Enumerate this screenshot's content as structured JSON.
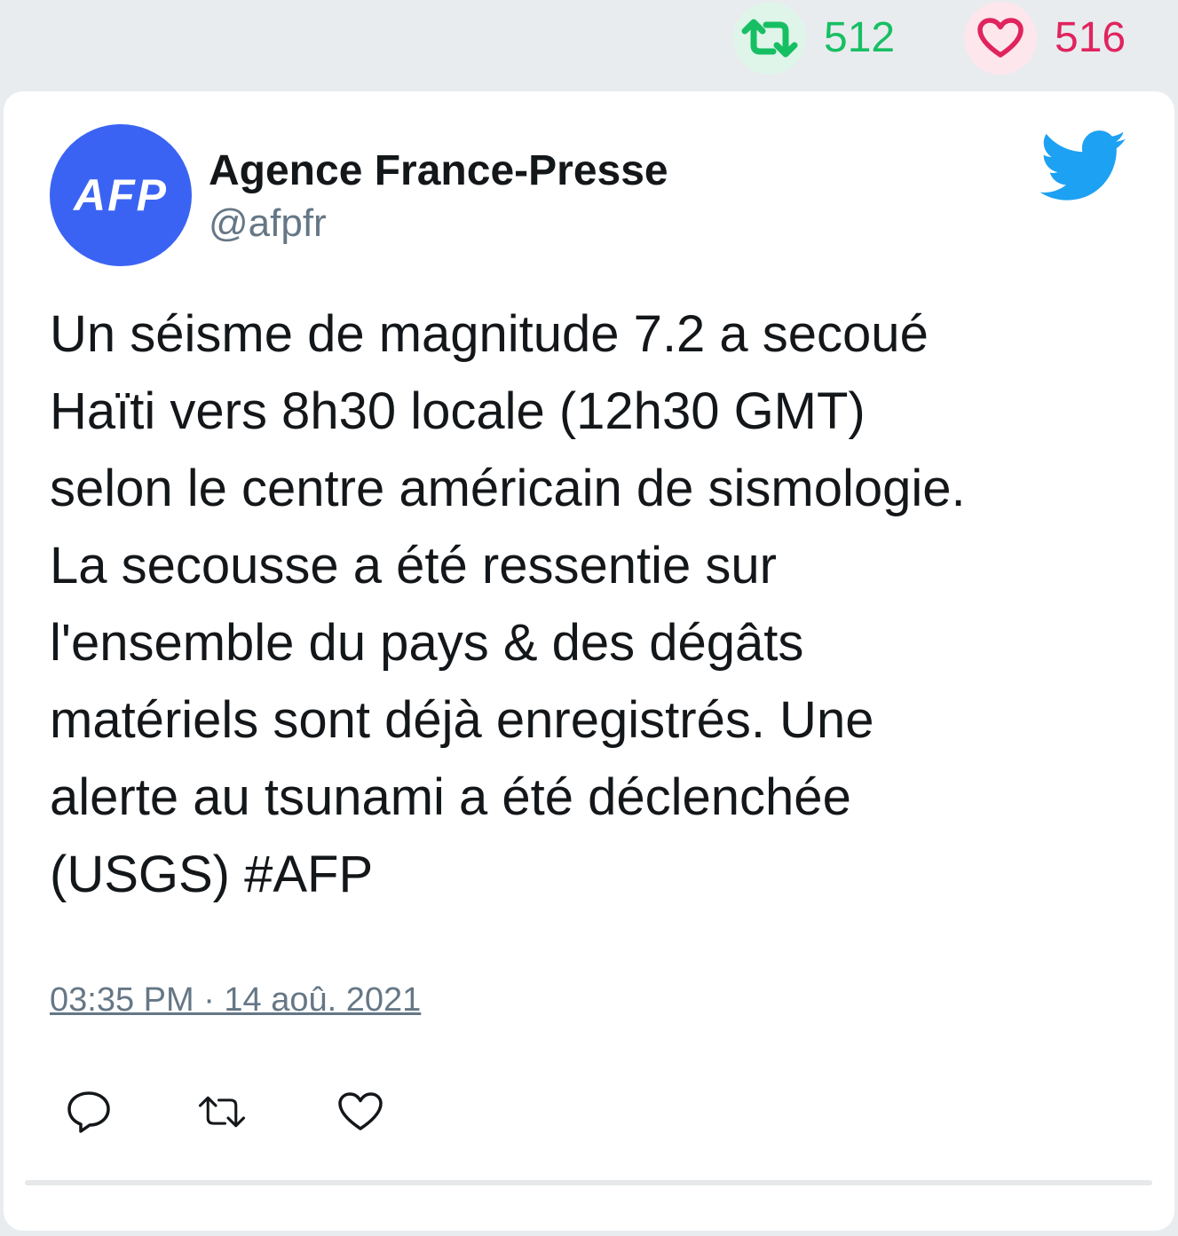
{
  "stats": {
    "retweets": {
      "count": "512",
      "icon": "retweet-icon",
      "color": "#17bf63"
    },
    "likes": {
      "count": "516",
      "icon": "heart-icon",
      "color": "#e0245e"
    }
  },
  "tweet": {
    "avatar_text": "AFP",
    "author_name": "Agence France-Presse",
    "author_handle": "@afpfr",
    "brand_icon": "twitter-bird-icon",
    "brand_color": "#1da1f2",
    "text_lines": [
      "Un séisme de magnitude 7.2 a secoué",
      "Haïti vers 8h30 locale (12h30 GMT)",
      "selon le centre américain de sismologie.",
      "La secousse a été ressentie sur",
      "l'ensemble du pays & des dégâts",
      "matériels sont déjà enregistrés. Une",
      "alerte au tsunami a été déclenchée",
      "(USGS) #AFP"
    ],
    "timestamp": "03:35 PM · 14 aoû. 2021"
  },
  "actions": [
    {
      "icon": "reply-icon"
    },
    {
      "icon": "retweet-icon"
    },
    {
      "icon": "heart-icon"
    }
  ]
}
